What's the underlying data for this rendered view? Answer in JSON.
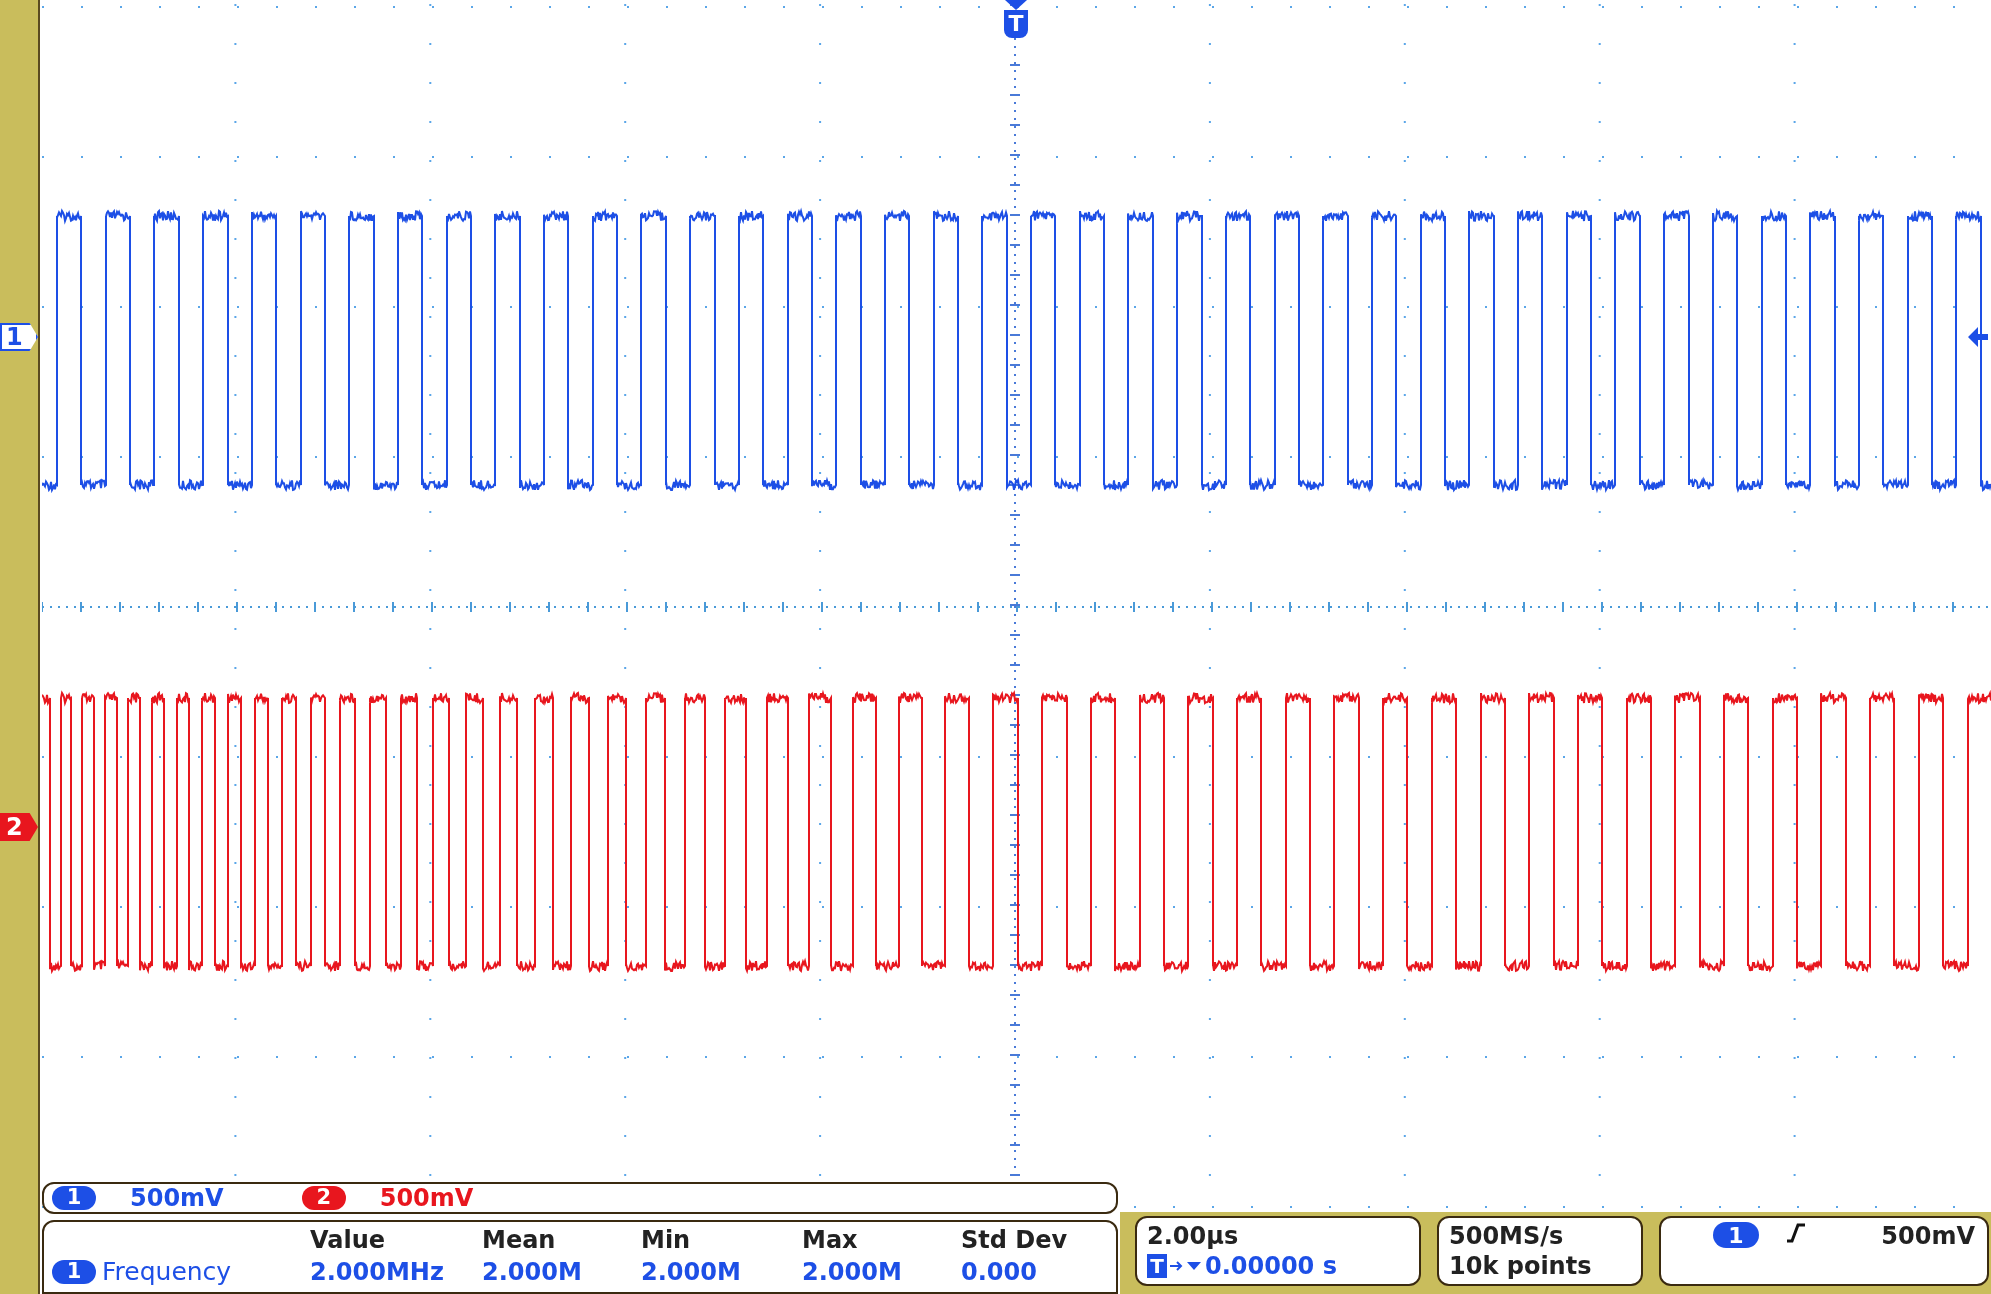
{
  "trigger_marker": {
    "label": "T"
  },
  "channel_markers": [
    {
      "label": "1",
      "color": "#1d4fe6"
    },
    {
      "label": "2",
      "color": "#e8161e"
    }
  ],
  "channels": [
    {
      "label": "1",
      "scale": "500mV",
      "color": "#1d4fe6"
    },
    {
      "label": "2",
      "scale": "500mV",
      "color": "#e8161e"
    }
  ],
  "measurements": {
    "headers": [
      "Value",
      "Mean",
      "Min",
      "Max",
      "Std Dev"
    ],
    "rows": [
      {
        "source": "1",
        "name": "Frequency",
        "values": [
          "2.000MHz",
          "2.000M",
          "2.000M",
          "2.000M",
          "0.000"
        ]
      }
    ]
  },
  "timebase": {
    "scale": "2.00µs",
    "marker": "T",
    "position": "0.00000 s"
  },
  "acquisition": {
    "rate": "500MS/s",
    "record": "10k points"
  },
  "trigger": {
    "source": "1",
    "level": "500mV"
  }
}
